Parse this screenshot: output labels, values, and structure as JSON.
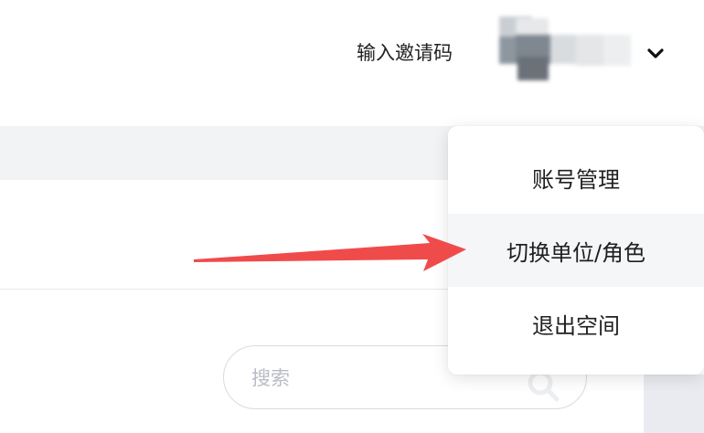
{
  "header": {
    "invite_label": "输入邀请码"
  },
  "search": {
    "placeholder": "搜索"
  },
  "dropdown": {
    "items": [
      {
        "label": "账号管理"
      },
      {
        "label": "切换单位/角色"
      },
      {
        "label": "退出空间"
      }
    ]
  },
  "colors": {
    "annotation_arrow": "#f04b4b",
    "menu_hover": "#f5f6f8",
    "band": "#f2f3f5"
  }
}
